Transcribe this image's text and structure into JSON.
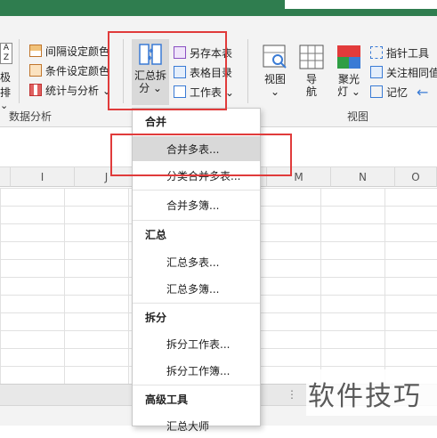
{
  "ribbon": {
    "data_analysis": {
      "left_partial_top": "A Z",
      "left_partial_mid": "极排",
      "left_partial_bot": "⌄",
      "items": [
        {
          "label": "间隔设定颜色",
          "icon": "interval-color-icon"
        },
        {
          "label": "条件设定颜色",
          "icon": "condition-color-icon"
        },
        {
          "label": "统计与分析 ⌄",
          "icon": "stats-icon"
        }
      ],
      "group_label": "数据分析"
    },
    "summary_split": {
      "label_line1": "汇总拆",
      "label_line2": "分 ⌄"
    },
    "file_tools": {
      "items": [
        {
          "label": "另存本表",
          "icon": "save-copy-icon"
        },
        {
          "label": "表格目录",
          "icon": "table-catalog-icon"
        },
        {
          "label": "工作表 ⌄",
          "icon": "worksheet-icon"
        }
      ]
    },
    "view": {
      "buttons": [
        {
          "line1": "视图",
          "line2": "⌄"
        },
        {
          "line1": "导",
          "line2": "航"
        },
        {
          "line1": "聚光",
          "line2": "灯 ⌄"
        }
      ],
      "right_items": [
        {
          "label": "指针工具",
          "icon": "pointer-tool-icon"
        },
        {
          "label": "关注相同值",
          "icon": "focus-same-icon"
        },
        {
          "label": "记忆",
          "icon": "memory-icon"
        }
      ],
      "back_arrow": "←",
      "group_label": "视图"
    }
  },
  "columns": [
    "I",
    "J",
    "M",
    "N",
    "O"
  ],
  "dropdown": {
    "sections": [
      {
        "title": "合并",
        "items": [
          "合并多表...",
          "分类合并多表...",
          "合并多簿..."
        ]
      },
      {
        "title": "汇总",
        "items": [
          "汇总多表...",
          "汇总多簿..."
        ]
      },
      {
        "title": "拆分",
        "items": [
          "拆分工作表...",
          "拆分工作簿..."
        ]
      },
      {
        "title": "高级工具",
        "items": [
          "汇总大师"
        ]
      }
    ]
  },
  "watermark": "软件技巧",
  "colors": {
    "excel_green": "#2f7d4f",
    "highlight_red": "#e03b3b"
  }
}
